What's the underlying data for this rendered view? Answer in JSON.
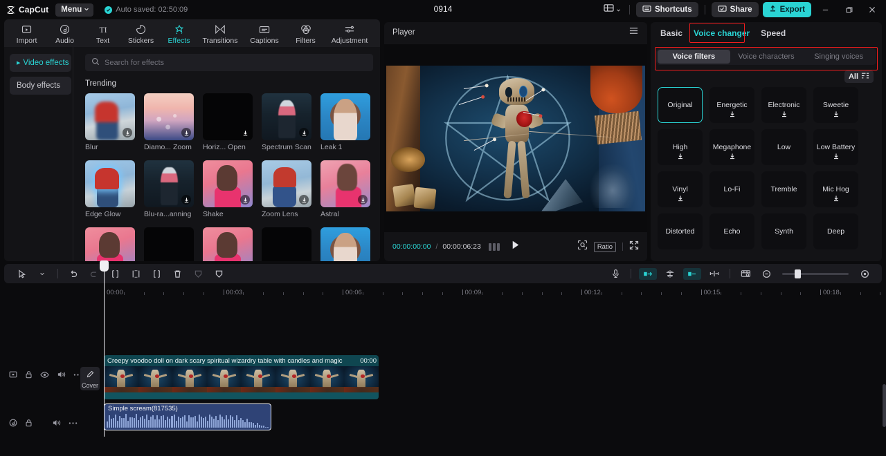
{
  "titlebar": {
    "app_name": "CapCut",
    "menu_label": "Menu",
    "autosave_text": "Auto saved: 02:50:09",
    "project_title": "0914",
    "shortcuts_label": "Shortcuts",
    "share_label": "Share",
    "export_label": "Export",
    "accent_color": "#2ad4d4"
  },
  "toolbar": {
    "items": [
      {
        "label": "Import",
        "icon": "import-icon",
        "active": false
      },
      {
        "label": "Audio",
        "icon": "audio-icon",
        "active": false
      },
      {
        "label": "Text",
        "icon": "text-icon",
        "active": false
      },
      {
        "label": "Stickers",
        "icon": "stickers-icon",
        "active": false
      },
      {
        "label": "Effects",
        "icon": "effects-icon",
        "active": true
      },
      {
        "label": "Transitions",
        "icon": "transitions-icon",
        "active": false
      },
      {
        "label": "Captions",
        "icon": "captions-icon",
        "active": false
      },
      {
        "label": "Filters",
        "icon": "filters-icon",
        "active": false
      },
      {
        "label": "Adjustment",
        "icon": "adjustment-icon",
        "active": false
      }
    ]
  },
  "left_panel": {
    "rail": [
      {
        "label": "Video effects",
        "active": true
      },
      {
        "label": "Body effects",
        "active": false
      }
    ],
    "search_placeholder": "Search for effects",
    "search_value": "",
    "section_title": "Trending",
    "effects": [
      {
        "name": "Blur",
        "art": "t-blur",
        "download": true
      },
      {
        "name": "Diamo... Zoom",
        "art": "t-diamond",
        "download": true
      },
      {
        "name": "Horiz... Open",
        "art": "t-black",
        "download": true
      },
      {
        "name": "Spectrum Scan",
        "art": "t-spectrum",
        "download": true
      },
      {
        "name": "Leak 1",
        "art": "t-leak",
        "download": false
      },
      {
        "name": "Edge Glow",
        "art": "t-edge",
        "download": false
      },
      {
        "name": "Blu-ra...anning",
        "art": "t-spectrum",
        "download": true
      },
      {
        "name": "Shake",
        "art": "t-shake",
        "download": true
      },
      {
        "name": "Zoom Lens",
        "art": "t-zoom",
        "download": true
      },
      {
        "name": "Astral",
        "art": "t-astral",
        "download": true
      },
      {
        "name": "",
        "art": "t-shake",
        "download": false
      },
      {
        "name": "",
        "art": "t-black",
        "download": false
      },
      {
        "name": "",
        "art": "t-shake",
        "download": false
      },
      {
        "name": "",
        "art": "t-black",
        "download": false
      },
      {
        "name": "",
        "art": "t-leak",
        "download": false
      }
    ]
  },
  "player": {
    "title": "Player",
    "current_time": "00:00:00:00",
    "separator": "/",
    "total_time": "00:00:06:23",
    "ratio_label": "Ratio",
    "play_icon": "play-icon"
  },
  "right_panel": {
    "tabs": [
      {
        "label": "Basic",
        "active": false
      },
      {
        "label": "Voice changer",
        "active": true
      },
      {
        "label": "Speed",
        "active": false
      }
    ],
    "segmented": [
      {
        "label": "Voice filters",
        "active": true
      },
      {
        "label": "Voice characters",
        "active": false
      },
      {
        "label": "Singing voices",
        "active": false
      }
    ],
    "filter_chip": "All",
    "highlight_color": "#ef1d1d",
    "voices": [
      {
        "name": "Original",
        "selected": true,
        "download": false
      },
      {
        "name": "Energetic",
        "selected": false,
        "download": true
      },
      {
        "name": "Electronic",
        "selected": false,
        "download": true
      },
      {
        "name": "Sweetie",
        "selected": false,
        "download": true
      },
      {
        "name": "High",
        "selected": false,
        "download": true
      },
      {
        "name": "Megaphone",
        "selected": false,
        "download": true
      },
      {
        "name": "Low",
        "selected": false,
        "download": false
      },
      {
        "name": "Low Battery",
        "selected": false,
        "download": true
      },
      {
        "name": "Vinyl",
        "selected": false,
        "download": true
      },
      {
        "name": "Lo-Fi",
        "selected": false,
        "download": false
      },
      {
        "name": "Tremble",
        "selected": false,
        "download": false
      },
      {
        "name": "Mic Hog",
        "selected": false,
        "download": true
      },
      {
        "name": "Distorted",
        "selected": false,
        "download": false
      },
      {
        "name": "Echo",
        "selected": false,
        "download": false
      },
      {
        "name": "Synth",
        "selected": false,
        "download": false
      },
      {
        "name": "Deep",
        "selected": false,
        "download": false
      }
    ]
  },
  "timeline": {
    "ruler_labels": [
      "00:00",
      "00:03",
      "00:06",
      "00:09",
      "00:12",
      "00:15",
      "00:18"
    ],
    "video_clip": {
      "title": "Creepy voodoo doll on dark scary spiritual wizardry table with candles and magic",
      "duration": "00:00"
    },
    "audio_clip": {
      "title": "Simple scream(817535)"
    },
    "cover_label": "Cover"
  }
}
